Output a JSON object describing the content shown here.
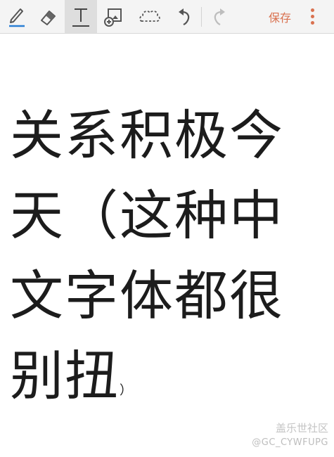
{
  "toolbar": {
    "tools": [
      {
        "name": "pen-icon",
        "active": false
      },
      {
        "name": "eraser-icon",
        "active": false
      },
      {
        "name": "text-icon",
        "active": true
      },
      {
        "name": "insert-image-icon",
        "active": false
      },
      {
        "name": "lasso-select-icon",
        "active": false
      },
      {
        "name": "undo-icon",
        "active": false
      },
      {
        "name": "redo-icon",
        "active": false
      }
    ],
    "save_label": "保存",
    "more_icon": "more-vertical-icon",
    "accent_color": "#d9714f",
    "pen_underline_color": "#2a7fd4"
  },
  "note": {
    "lines": [
      "关系积极今",
      "天（这种中",
      "文字体都很",
      "别扭"
    ],
    "tail": "）"
  },
  "watermark": {
    "community": "盖乐世社区",
    "user": "@GC_CYWFUPG"
  }
}
